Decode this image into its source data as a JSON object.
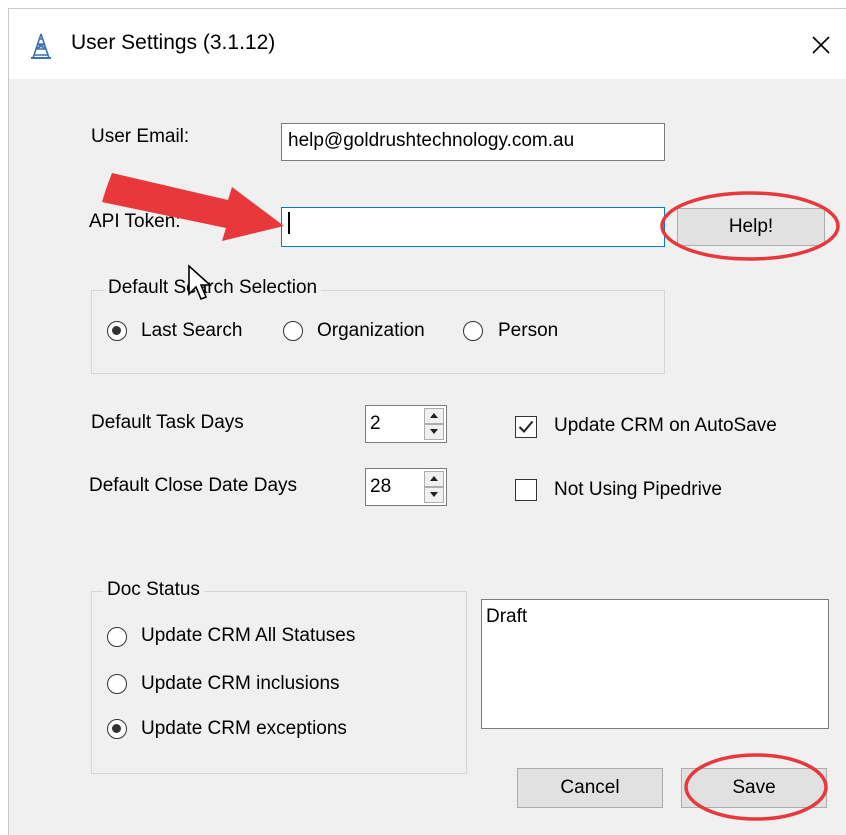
{
  "window": {
    "title": "User Settings (3.1.12)",
    "close_icon": "close-icon",
    "app_icon": "derrick-tower-icon"
  },
  "fields": {
    "user_email_label": "User Email:",
    "user_email_value": "help@goldrushtechnology.com.au",
    "api_token_label": "API Token:",
    "api_token_value": "",
    "help_button": "Help!"
  },
  "search_selection": {
    "legend": "Default Search Selection",
    "options": [
      {
        "label": "Last Search",
        "checked": true
      },
      {
        "label": "Organization",
        "checked": false
      },
      {
        "label": "Person",
        "checked": false
      }
    ]
  },
  "task": {
    "task_days_label": "Default Task Days",
    "task_days_value": "2",
    "close_days_label": "Default Close Date Days",
    "close_days_value": "28"
  },
  "checkboxes": {
    "update_crm_autosave_label": "Update CRM on AutoSave",
    "update_crm_autosave_checked": true,
    "not_using_pipedrive_label": "Not Using Pipedrive",
    "not_using_pipedrive_checked": false
  },
  "doc_status": {
    "legend": "Doc Status",
    "options": [
      {
        "label": "Update CRM All Statuses",
        "checked": false
      },
      {
        "label": "Update CRM inclusions",
        "checked": false
      },
      {
        "label": "Update CRM exceptions",
        "checked": true
      }
    ],
    "list_items": [
      "Draft"
    ]
  },
  "buttons": {
    "cancel": "Cancel",
    "save": "Save"
  },
  "colors": {
    "annotation_red": "#e8383b",
    "focus_border": "#0078d7"
  }
}
